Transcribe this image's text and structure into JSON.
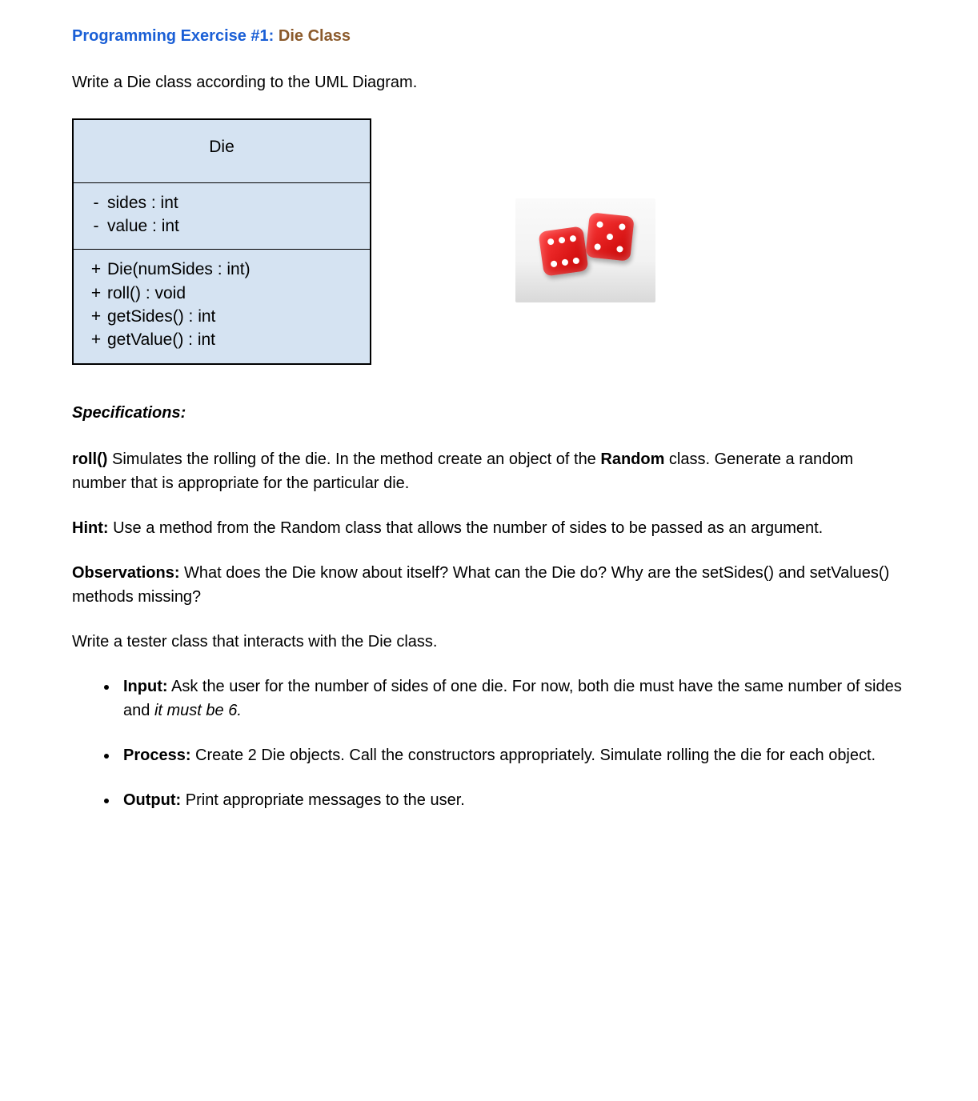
{
  "title": {
    "part1": "Programming Exercise #1: ",
    "part2": "Die Class"
  },
  "intro": "Write a Die class according to the UML Diagram.",
  "uml": {
    "class_name": "Die",
    "attributes": [
      {
        "vis": "-",
        "sig": "sides : int"
      },
      {
        "vis": "-",
        "sig": "value : int"
      }
    ],
    "methods": [
      {
        "vis": "+",
        "sig": "Die(numSides : int)"
      },
      {
        "vis": "+",
        "sig": "roll() : void"
      },
      {
        "vis": "+",
        "sig": "getSides() : int"
      },
      {
        "vis": "+",
        "sig": "getValue() : int"
      }
    ]
  },
  "image_alt": "Two red dice",
  "spec": {
    "heading": "Specifications:",
    "roll_label": "roll()",
    "roll_text_a": " Simulates the rolling of the die. In the method create an object of the ",
    "roll_random": "Random",
    "roll_text_b": " class. Generate a random number that is appropriate for the particular die.",
    "hint_label": "Hint:",
    "hint_text": " Use a method from the Random class that allows the number of sides to be passed as an argument.",
    "obs_label": "Observations:",
    "obs_text": " What does the Die know about itself? What can the Die do? Why are the setSides() and setValues() methods missing?",
    "tester_text": "Write a tester class that interacts with the Die class.",
    "tasks": [
      {
        "label": "Input:",
        "text_a": " Ask the user for the number of sides of one die. For now, both die must have the same number of sides and ",
        "italic": "it must be 6.",
        "text_b": ""
      },
      {
        "label": "Process:",
        "text_a": " Create 2 Die objects. Call the constructors appropriately. Simulate rolling the die for each object.",
        "italic": "",
        "text_b": ""
      },
      {
        "label": "Output:",
        "text_a": " Print appropriate messages to the user.",
        "italic": "",
        "text_b": ""
      }
    ]
  }
}
